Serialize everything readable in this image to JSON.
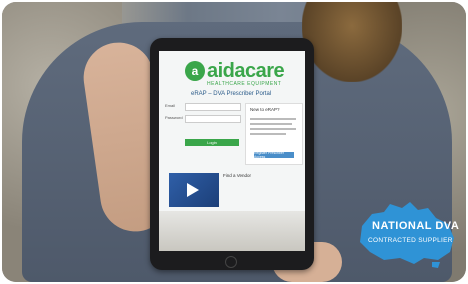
{
  "logo": {
    "mark": "a",
    "name": "aidacare",
    "tagline": "HEALTHCARE EQUIPMENT"
  },
  "portal": {
    "title": "eRAP – DVA Prescriber Portal"
  },
  "login": {
    "email_label": "Email",
    "password_label": "Password",
    "login_label": "Login"
  },
  "sidebar": {
    "title": "New to eRAP?",
    "register_label": "Register Prescriber Access"
  },
  "find": {
    "title": "Find a Vendor"
  },
  "badge": {
    "line1": "NATIONAL DVA",
    "line2": "CONTRACTED SUPPLIER",
    "color": "#2f93d6"
  }
}
